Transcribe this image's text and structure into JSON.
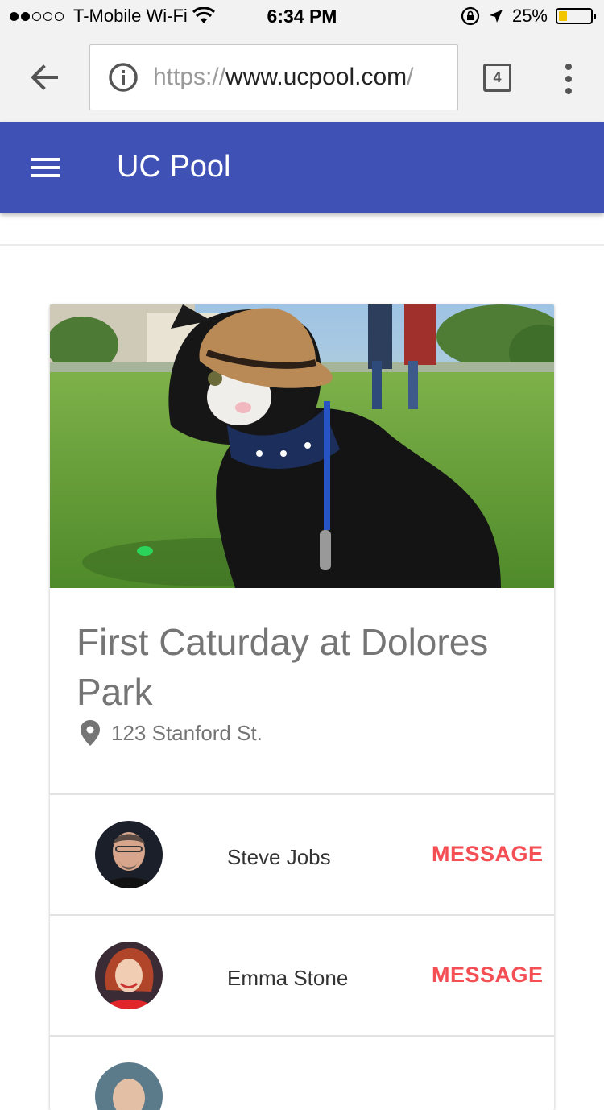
{
  "status_bar": {
    "carrier": "T-Mobile Wi-Fi",
    "time": "6:34 PM",
    "battery": "25%",
    "battery_level": 0.25,
    "signal_bars_filled": 2,
    "signal_bars_total": 5
  },
  "browser": {
    "url_scheme": "https://",
    "url_host": "www.ucpool.com",
    "url_rest": "/",
    "tab_count": "4"
  },
  "app_bar": {
    "title": "UC Pool",
    "color": "#3f51b5"
  },
  "event": {
    "title": "First Caturday at Dolores Park",
    "address": "123 Stanford St.",
    "image_icon": "cat-in-park-photo"
  },
  "attendees": [
    {
      "name": "Steve Jobs",
      "action": "MESSAGE"
    },
    {
      "name": "Emma Stone",
      "action": "MESSAGE"
    }
  ],
  "colors": {
    "accent": "#f44f55",
    "text_muted": "#757575"
  }
}
